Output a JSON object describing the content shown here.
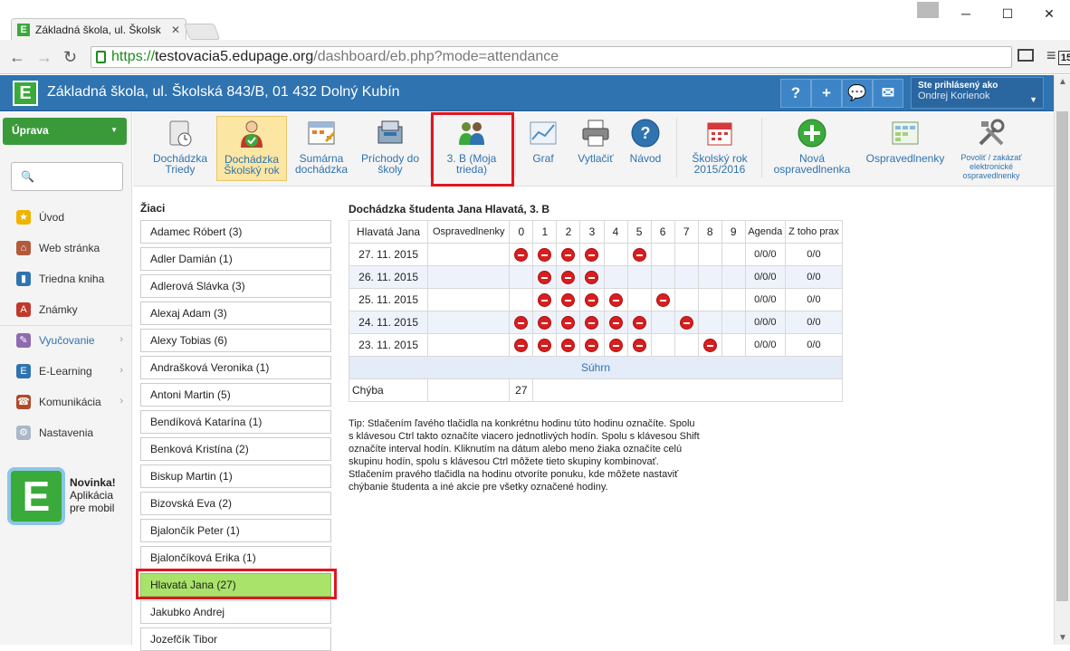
{
  "browser": {
    "tab_title": "Základná škola, ul. Školsk",
    "url_scheme": "https://",
    "url_domain": "testovacia5.edupage.org",
    "url_path": "/dashboard/eb.php?mode=attendance",
    "ext_badge": "15"
  },
  "app": {
    "title": "Základná škola, ul. Školská 843/B, 01 432 Dolný Kubín",
    "logo": "E",
    "login_label": "Ste prihlásený ako",
    "login_user": "Ondrej Korienok"
  },
  "sidebar": {
    "edit_button": "Úprava",
    "items": [
      {
        "label": "Úvod",
        "icon": "star-icon"
      },
      {
        "label": "Web stránka",
        "icon": "web-icon"
      },
      {
        "label": "Triedna kniha",
        "icon": "book-icon"
      },
      {
        "label": "Známky",
        "icon": "grades-icon"
      },
      {
        "label": "Vyučovanie",
        "icon": "teaching-icon"
      },
      {
        "label": "E-Learning",
        "icon": "elearning-icon"
      },
      {
        "label": "Komunikácia",
        "icon": "communication-icon"
      },
      {
        "label": "Nastavenia",
        "icon": "settings-icon"
      }
    ],
    "promo_title": "Novinka!",
    "promo_line1": "Aplikácia",
    "promo_line2": "pre mobil"
  },
  "toolbar": {
    "items": [
      {
        "l1": "Dochádzka",
        "l2": "Triedy"
      },
      {
        "l1": "Dochádzka",
        "l2": "Školský rok"
      },
      {
        "l1": "Sumárna",
        "l2": "dochádzka"
      },
      {
        "l1": "Príchody do",
        "l2": "školy"
      },
      {
        "l1": "3. B (Moja",
        "l2": "trieda)"
      },
      {
        "l1": "Graf",
        "l2": ""
      },
      {
        "l1": "Vytlačiť",
        "l2": ""
      },
      {
        "l1": "Návod",
        "l2": ""
      },
      {
        "l1": "Školský rok",
        "l2": "2015/2016"
      },
      {
        "l1": "Nová",
        "l2": "ospravedlnenka"
      },
      {
        "l1": "Ospravedlnenky",
        "l2": ""
      },
      {
        "l1": "Povoliť / zakázať",
        "l2": "elektronické",
        "l3": "ospravedlnenky"
      }
    ]
  },
  "students": {
    "heading": "Žiaci",
    "list": [
      "Adamec Róbert (3)",
      "Adler Damián (1)",
      "Adlerová Slávka (3)",
      "Alexaj Adam (3)",
      "Alexy Tobias (6)",
      "Andrašková Veronika (1)",
      "Antoni Martin (5)",
      "Bendíková Katarína (1)",
      "Benková Kristína (2)",
      "Biskup Martin (1)",
      "Bizovská Eva (2)",
      "Bjalončík Peter (1)",
      "Bjalončíková Erika (1)",
      "Hlavatá Jana (27)",
      "Jakubko Andrej",
      "Jozefčík Tibor"
    ]
  },
  "attendance": {
    "heading": "Dochádzka študenta Jana Hlavatá, 3. B",
    "header_name": "Hlavatá Jana",
    "header_excuse": "Ospravedlnenky",
    "hours": [
      "0",
      "1",
      "2",
      "3",
      "4",
      "5",
      "6",
      "7",
      "8",
      "9"
    ],
    "header_agenda": "Agenda",
    "header_practice": "Z toho prax",
    "rows": [
      {
        "date": "27. 11. 2015",
        "absent": [
          0,
          1,
          2,
          3,
          5
        ],
        "agenda": "0/0/0",
        "practice": "0/0"
      },
      {
        "date": "26. 11. 2015",
        "absent": [
          1,
          2,
          3
        ],
        "agenda": "0/0/0",
        "practice": "0/0"
      },
      {
        "date": "25. 11. 2015",
        "absent": [
          1,
          2,
          3,
          4,
          6
        ],
        "agenda": "0/0/0",
        "practice": "0/0"
      },
      {
        "date": "24. 11. 2015",
        "absent": [
          0,
          1,
          2,
          3,
          4,
          5,
          7
        ],
        "agenda": "0/0/0",
        "practice": "0/0"
      },
      {
        "date": "23. 11. 2015",
        "absent": [
          0,
          1,
          2,
          3,
          4,
          5,
          8
        ],
        "agenda": "0/0/0",
        "practice": "0/0"
      }
    ],
    "summary_label": "Súhrn",
    "missing_label": "Chýba",
    "missing_value": "27"
  },
  "tip": {
    "text": "Tip: Stlačením ľavého tlačidla na konkrétnu hodinu túto hodinu označíte. Spolu s klávesou Ctrl takto označíte viacero jednotlivých hodín. Spolu s klávesou Shift označíte interval hodín. Kliknutím na dátum alebo meno žiaka označíte celú skupinu hodín, spolu s klávesou Ctrl môžete tieto skupiny kombinovať.",
    "text2": "Stlačením pravého tlačidla na hodinu otvoríte ponuku, kde môžete nastaviť chýbanie študenta a iné akcie pre všetky označené hodiny."
  }
}
